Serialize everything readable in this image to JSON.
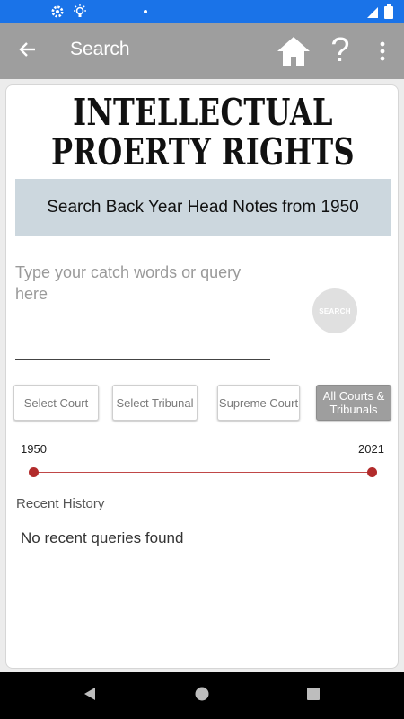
{
  "app_bar": {
    "title": "Search"
  },
  "header": {
    "logo_line1": "INTELLECTUAL",
    "logo_line2": "PROERTY RIGHTS",
    "subtitle": "Search Back Year Head Notes from 1950"
  },
  "search": {
    "placeholder": "Type your catch words or query here",
    "value": "",
    "button_label": "SEARCH"
  },
  "filters": [
    {
      "label": "Select Court",
      "active": false
    },
    {
      "label": "Select Tribunal",
      "active": false
    },
    {
      "label": "Supreme Court",
      "active": false
    },
    {
      "label": "All Courts & Tribunals",
      "active": true
    }
  ],
  "year_range": {
    "min_label": "1950",
    "max_label": "2021",
    "selected_from": 1950,
    "selected_to": 2021
  },
  "history": {
    "label": "Recent History",
    "empty_message": "No recent queries found"
  },
  "icons": {
    "status": [
      "gear-icon",
      "brightness-icon",
      "signal-icon",
      "battery-icon"
    ],
    "app_bar": [
      "back-arrow-icon",
      "home-icon",
      "help-icon",
      "more-vert-icon"
    ],
    "nav": [
      "back-triangle-icon",
      "home-circle-icon",
      "recents-square-icon"
    ]
  },
  "colors": {
    "status_bar": "#1a73e8",
    "app_bar": "#9e9e9e",
    "subtitle_bg": "#ccd7de",
    "slider": "#b22b2b"
  }
}
